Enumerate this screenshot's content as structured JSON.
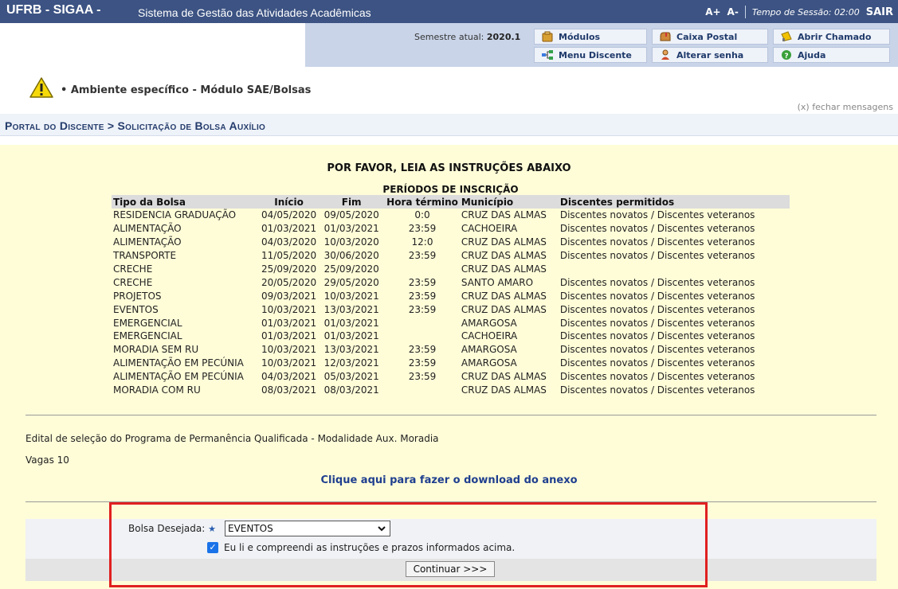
{
  "topbar": {
    "system": "UFRB - SIGAA -",
    "system_name": "Sistema de Gestão das Atividades Acadêmicas",
    "font_increase": "A+",
    "font_decrease": "A-",
    "session": "Tempo de Sessão: 02:00",
    "logout": "SAIR",
    "bg_color": "#3c5383"
  },
  "info": {
    "semestre_label": "Semestre atual:",
    "semestre_value": "2020.1",
    "menu": {
      "modulos": "Módulos",
      "caixa_postal": "Caixa Postal",
      "abrir_chamado": "Abrir Chamado",
      "menu_discente": "Menu Discente",
      "alterar_senha": "Alterar senha",
      "ajuda": "Ajuda"
    }
  },
  "messages": {
    "warning": "Ambiente específico - Módulo SAE/Bolsas",
    "close": "(x) fechar mensagens"
  },
  "breadcrumb": "Portal do Discente > Solicitação de Bolsa Auxílio",
  "instructions": {
    "title": "POR FAVOR, LEIA AS INSTRUÇÕES ABAIXO",
    "periodos_title": "PERÍODOS DE INSCRIÇÃO"
  },
  "table": {
    "headers": [
      "Tipo da Bolsa",
      "Início",
      "Fim",
      "Hora término",
      "Município",
      "Discentes permitidos"
    ],
    "rows": [
      [
        "RESIDENCIA GRADUAÇÃO",
        "04/05/2020",
        "09/05/2020",
        "0:0",
        "CRUZ DAS ALMAS",
        "Discentes novatos / Discentes veteranos"
      ],
      [
        "ALIMENTAÇÃO",
        "01/03/2021",
        "01/03/2021",
        "23:59",
        "CACHOEIRA",
        "Discentes novatos / Discentes veteranos"
      ],
      [
        "ALIMENTAÇÃO",
        "04/03/2020",
        "10/03/2020",
        "12:0",
        "CRUZ DAS ALMAS",
        "Discentes novatos / Discentes veteranos"
      ],
      [
        "TRANSPORTE",
        "11/05/2020",
        "30/06/2020",
        "23:59",
        "CRUZ DAS ALMAS",
        "Discentes novatos / Discentes veteranos"
      ],
      [
        "CRECHE",
        "25/09/2020",
        "25/09/2020",
        "",
        "CRUZ DAS ALMAS",
        ""
      ],
      [
        "CRECHE",
        "20/05/2020",
        "29/05/2020",
        "23:59",
        "SANTO AMARO",
        "Discentes novatos / Discentes veteranos"
      ],
      [
        "PROJETOS",
        "09/03/2021",
        "10/03/2021",
        "23:59",
        "CRUZ DAS ALMAS",
        "Discentes novatos / Discentes veteranos"
      ],
      [
        "EVENTOS",
        "10/03/2021",
        "13/03/2021",
        "23:59",
        "CRUZ DAS ALMAS",
        "Discentes novatos / Discentes veteranos"
      ],
      [
        "EMERGENCIAL",
        "01/03/2021",
        "01/03/2021",
        "",
        "AMARGOSA",
        "Discentes novatos / Discentes veteranos"
      ],
      [
        "EMERGENCIAL",
        "01/03/2021",
        "01/03/2021",
        "",
        "CACHOEIRA",
        "Discentes novatos / Discentes veteranos"
      ],
      [
        "MORADIA SEM RU",
        "10/03/2021",
        "13/03/2021",
        "23:59",
        "AMARGOSA",
        "Discentes novatos / Discentes veteranos"
      ],
      [
        "ALIMENTAÇÃO EM PECÚNIA",
        "10/03/2021",
        "12/03/2021",
        "23:59",
        "AMARGOSA",
        "Discentes novatos / Discentes veteranos"
      ],
      [
        "ALIMENTAÇÃO EM PECÚNIA",
        "04/03/2021",
        "05/03/2021",
        "23:59",
        "CRUZ DAS ALMAS",
        "Discentes novatos / Discentes veteranos"
      ],
      [
        "MORADIA COM RU",
        "08/03/2021",
        "08/03/2021",
        "",
        "CRUZ DAS ALMAS",
        "Discentes novatos / Discentes veteranos"
      ]
    ]
  },
  "edital": "Edital de seleção do Programa de Permanência Qualificada - Modalidade Aux. Moradia",
  "vagas": "Vagas 10",
  "download_link": "Clique aqui para fazer o download do anexo",
  "form": {
    "bolsa_label": "Bolsa Desejada:",
    "required_mark": "★",
    "bolsa_selected": "EVENTOS",
    "checkbox_checked": true,
    "checkbox_label": "Eu li e compreendi as instruções e prazos informados acima.",
    "submit": "Continuar >>>"
  },
  "colors": {
    "panel_bg": "#fffdd8",
    "info_bg": "#c9d4e8",
    "highlight_border": "#e02020",
    "link": "#1f3f8f"
  }
}
